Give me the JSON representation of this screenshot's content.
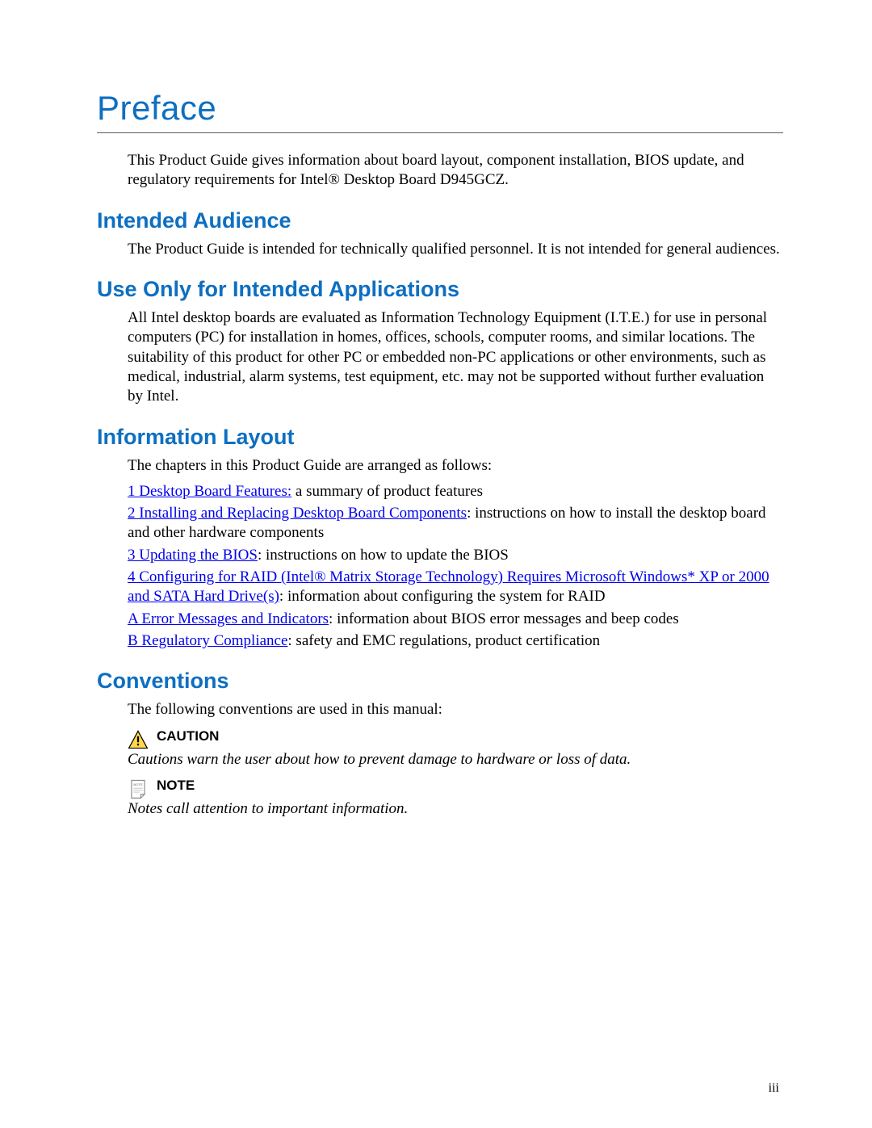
{
  "title": "Preface",
  "intro": "This Product Guide gives information about board layout, component installation, BIOS update, and regulatory requirements for Intel® Desktop Board D945GCZ.",
  "sections": {
    "audience": {
      "heading": "Intended Audience",
      "body": "The Product Guide is intended for technically qualified personnel.  It is not intended for general audiences."
    },
    "use_only": {
      "heading": "Use Only for Intended Applications",
      "body": "All Intel desktop boards are evaluated as Information Technology Equipment (I.T.E.) for use in personal computers (PC) for installation in homes, offices, schools, computer rooms, and similar locations. The suitability of this product for other PC or embedded non-PC applications or other environments, such as medical, industrial, alarm systems, test equipment, etc. may not be supported without further evaluation by Intel."
    },
    "info_layout": {
      "heading": "Information Layout",
      "lead": "The chapters in this Product Guide are arranged as follows:",
      "items": [
        {
          "link": "1  Desktop Board Features:",
          "rest": "  a summary of product features"
        },
        {
          "link": "2  Installing and Replacing Desktop Board Components",
          "rest": ":  instructions on how to install the desktop board and other hardware components"
        },
        {
          "link": "3  Updating the BIOS",
          "rest": ":  instructions on how to update the BIOS"
        },
        {
          "link": "4  Configuring for RAID (Intel® Matrix Storage Technology) Requires Microsoft Windows* XP or 2000 and SATA Hard Drive(s)",
          "rest": ":  information about configuring the system for RAID"
        },
        {
          "link": "A  Error Messages and Indicators",
          "rest": ":  information about BIOS error messages and beep codes"
        },
        {
          "link": "B  Regulatory Compliance",
          "rest": ":  safety and EMC regulations, product certification"
        }
      ]
    },
    "conventions": {
      "heading": "Conventions",
      "lead": "The following conventions are used in this manual:",
      "caution_label": "CAUTION",
      "caution_text": "Cautions warn the user about how to prevent damage to hardware or loss of data.",
      "note_label": "NOTE",
      "note_text": "Notes call attention to important information."
    }
  },
  "page_number": "iii"
}
